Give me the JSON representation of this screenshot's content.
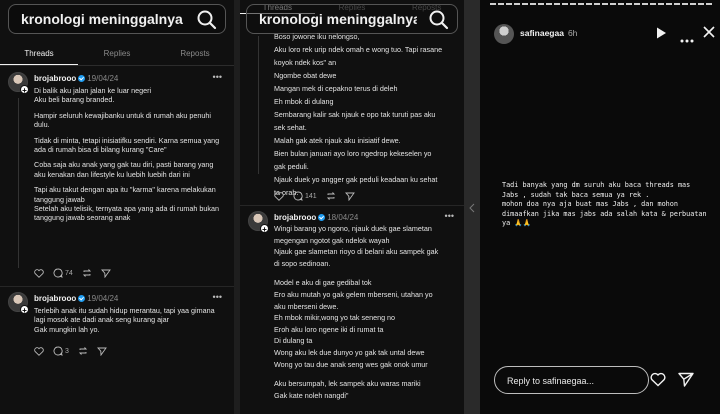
{
  "left_panel": {
    "search": {
      "query": "kronologi meninggalnya da..."
    },
    "tabs": [
      "Threads",
      "Replies",
      "Reposts"
    ],
    "post1": {
      "username": "brojabrooo",
      "date": "19/04/24",
      "paragraphs": [
        "Di balik aku jalan jalan ke luar negeri\nAku beli barang branded.",
        "Hampir seluruh kewajibanku untuk di rumah aku penuhi dulu.",
        "Tidak di minta, tetapi inisiatifku sendiri. Karna semua yang ada di rumah bisa di bilang kurang \"Care\"",
        "Coba saja aku anak yang gak tau diri, pasti barang yang aku kenakan dan lifestyle ku luebih luebih dari ini",
        "Tapi aku takut dengan apa itu \"karma\" karena melakukan tanggung jawab",
        "Setelah aku telisik, ternyata apa yang ada di rumah bukan tanggung jawab seorang anak"
      ],
      "reply_count": "74"
    },
    "post2": {
      "username": "brojabrooo",
      "date": "19/04/24",
      "text": "Terlebih anak itu sudah hidup merantau, tapi yaa gimana lagi mosok ate dadi anak seng kurang ajar\nGak mungkin lah yo.",
      "reply_count": "3"
    }
  },
  "middle_panel": {
    "search": {
      "query": "kronologi meninggalnya da..."
    },
    "tabs": [
      "Threads",
      "Replies",
      "Reposts"
    ],
    "post1_lines": [
      "Boso jowone iku nelongso,",
      "Aku loro rek urip ndek omah e wong tuo. Tapi rasane",
      "koyok ndek kos\" an",
      "Ngombe obat dewe",
      "Mangan mek di cepakno terus di deleh",
      "Eh mbok di dulang",
      "Sembarang kalir sak njauk e opo tak turuti pas aku",
      "sek sehat.",
      "Malah gak atek njauk aku inisiatif dewe.",
      "Bien bulan januari ayo loro ngedrop kekeselen yo",
      "gak peduli.",
      "Njauk duek yo angger gak peduli keadaan ku sehat",
      "ta orah."
    ],
    "post1_reply_count": "141",
    "post2": {
      "username": "brojabrooo",
      "date": "18/04/24",
      "lines": [
        "Wingi barang yo ngono, njauk duek gae slametan",
        "megengan ngotot gak ndelok wayah",
        "Njauk gae slametan rioyo di belani aku sampek gak",
        "di sopo sedinoan.",
        "",
        "Model e aku di gae gedibal tok",
        "Ero aku mutah yo gak gelem mberseni, utahan yo",
        "aku mberseni dewe.",
        "Eh mbok mikir,wong yo tak seneng no",
        "Eroh aku loro ngene iki di rumat ta",
        "Di dulang ta",
        "Wong aku lek due dunyo yo gak tak untal dewe",
        "Wong yo tau due anak seng wes gak onok umur",
        "",
        "Aku bersumpah, lek sampek aku waras mariki",
        "Gak kate noleh nangdi\""
      ]
    }
  },
  "right_panel": {
    "username": "safinaegaa",
    "time": "6h",
    "story_text": "Tadi banyak yang dm suruh aku baca threads mas Jabs , sudah tak baca semua ya rek .\nmohon doa nya aja buat mas Jabs , dan mohon dimaafkan jika mas jabs ada salah kata & perbuatan ya 🙏🙏",
    "reply_placeholder": "Reply to safinaegaa..."
  }
}
